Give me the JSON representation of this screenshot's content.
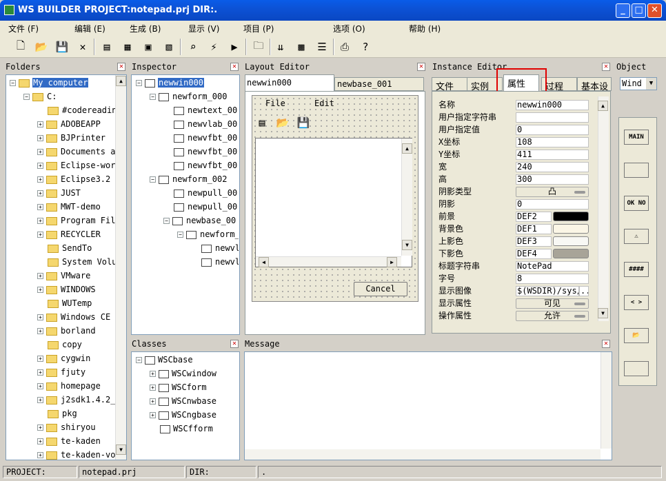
{
  "window": {
    "title": "WS BUILDER PROJECT:notepad.prj DIR:."
  },
  "menu": [
    "文件 (F)",
    "编辑 (E)",
    "生成 (B)",
    "显示 (V)",
    "项目 (P)",
    "选项 (O)",
    "帮助 (H)"
  ],
  "panels": {
    "folders": "Folders",
    "inspector": "Inspector",
    "layout": "Layout Editor",
    "instance": "Instance Editor",
    "object": "Object",
    "classes": "Classes",
    "message": "Message"
  },
  "folders": [
    "My computer",
    "C:",
    "#codereadin",
    "ADOBEAPP",
    "BJPrinter",
    "Documents a",
    "Eclipse-wor",
    "Eclipse3.2",
    "JUST",
    "MWT-demo",
    "Program Fil",
    "RECYCLER",
    "SendTo",
    "System Volu",
    "VMware",
    "WINDOWS",
    "WUTemp",
    "Windows CE",
    "borland",
    "copy",
    "cygwin",
    "fjuty",
    "homepage",
    "j2sdk1.4.2_",
    "pkg",
    "shiryou",
    "te-kaden",
    "te-kaden-vo"
  ],
  "inspector": [
    "newwin000",
    "newform_000",
    "newtext_00",
    "newvlab_00",
    "newvfbt_00",
    "newvfbt_00",
    "newvfbt_00",
    "newform_002",
    "newpull_00",
    "newpull_00",
    "newbase_00",
    "newform_",
    "newvl",
    "newvl"
  ],
  "classes": [
    "WSCbase",
    "WSCwindow",
    "WSCform",
    "WSCnwbase",
    "WSCngbase",
    "WSCfform"
  ],
  "layout": {
    "tabs": [
      "newwin000",
      "newbase_001"
    ],
    "menu_file": "File",
    "menu_edit": "Edit",
    "cancel": "Cancel"
  },
  "instance": {
    "tabs": [
      "文件",
      "实例",
      "属性",
      "过程",
      "基本设"
    ],
    "props": [
      {
        "k": "名称",
        "v": "newwin000"
      },
      {
        "k": "用户指定字符串",
        "v": ""
      },
      {
        "k": "用户指定值",
        "v": "0"
      },
      {
        "k": "X坐标",
        "v": "108"
      },
      {
        "k": "Y坐标",
        "v": "411"
      },
      {
        "k": "宽",
        "v": "240"
      },
      {
        "k": "高",
        "v": "300"
      },
      {
        "k": "阴影类型",
        "v": "凸"
      },
      {
        "k": "阴影",
        "v": "0"
      },
      {
        "k": "前景",
        "v": "DEF2"
      },
      {
        "k": "背景色",
        "v": "DEF1"
      },
      {
        "k": "上影色",
        "v": "DEF3"
      },
      {
        "k": "下影色",
        "v": "DEF4"
      },
      {
        "k": "标题字符串",
        "v": "NotePad"
      },
      {
        "k": "字号",
        "v": "8"
      },
      {
        "k": "显示图像",
        "v": "$(WSDIR)/sys/"
      },
      {
        "k": "显示属性",
        "v": "可见"
      },
      {
        "k": "操作属性",
        "v": "允许"
      }
    ],
    "swatches": [
      "#000000",
      "#fbf6e6",
      "#f8f8f4",
      "#a8a498"
    ]
  },
  "object": {
    "select": "Wind",
    "buttons": [
      "MAIN",
      "",
      "OK NO",
      "⚠",
      "####",
      "< >",
      "📂",
      ""
    ]
  },
  "status": {
    "project_label": "PROJECT:",
    "project": "notepad.prj",
    "dir_label": "DIR:",
    "dir": "."
  }
}
